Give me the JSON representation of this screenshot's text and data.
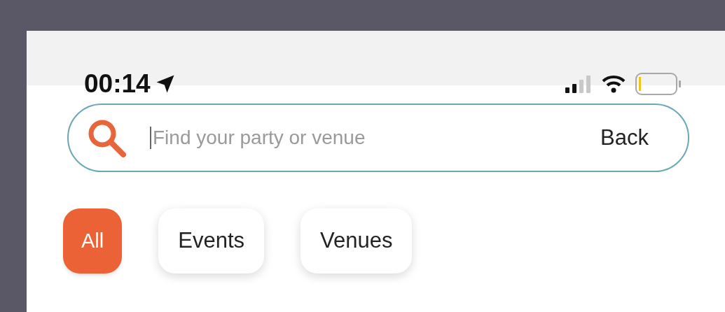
{
  "status_bar": {
    "time": "00:14"
  },
  "search": {
    "placeholder": "Find your party or venue",
    "action": "Back"
  },
  "filters": [
    {
      "label": "All",
      "selected": true
    },
    {
      "label": "Events",
      "selected": false
    },
    {
      "label": "Venues",
      "selected": false
    }
  ]
}
